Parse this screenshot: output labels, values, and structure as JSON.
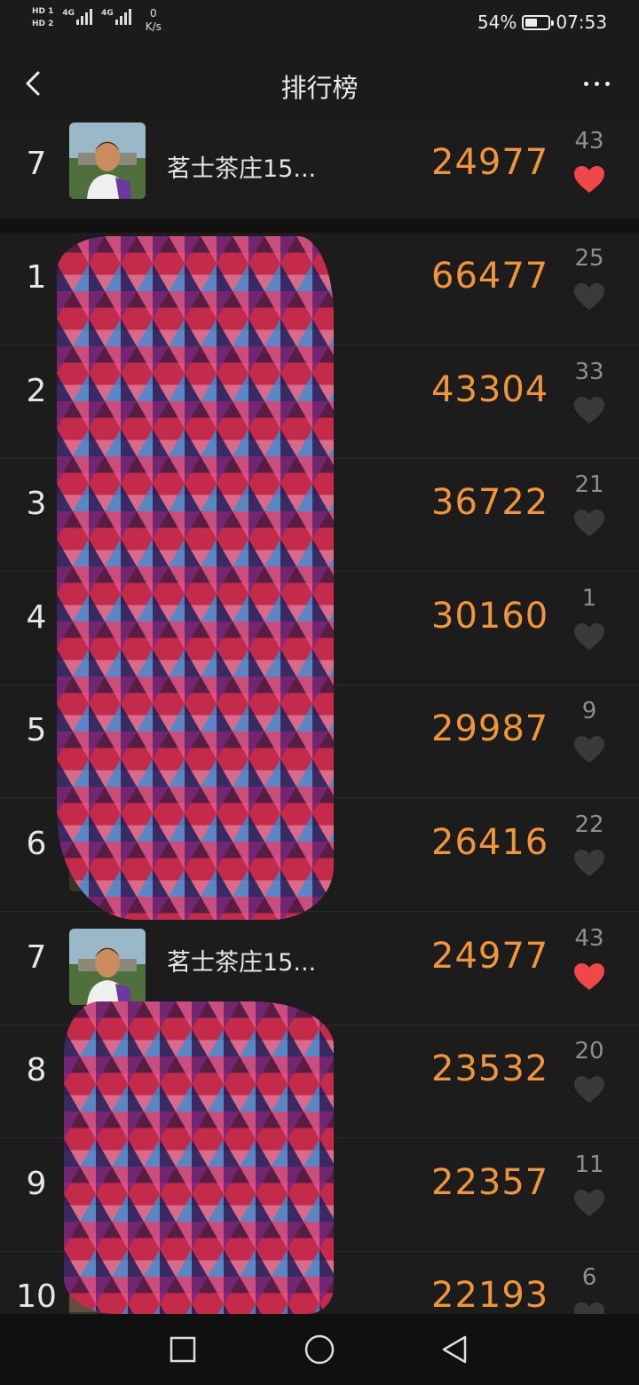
{
  "status_bar": {
    "sim1": "HD 1",
    "sim2": "HD 2",
    "net1": "4G",
    "net2": "4G",
    "speed_value": "0",
    "speed_unit": "K/s",
    "battery_percent": "54%",
    "battery_level": 0.54,
    "time": "07:53"
  },
  "header": {
    "title": "排行榜",
    "back_icon": "chevron-left-icon",
    "more_icon": "more-dots-icon"
  },
  "my_rank": {
    "rank": "7",
    "name": "茗士茶庄15...",
    "score": "24977",
    "likes": "43",
    "liked": true
  },
  "leaderboard": [
    {
      "rank": "1",
      "name": "",
      "score": "66477",
      "likes": "25",
      "liked": false
    },
    {
      "rank": "2",
      "name": "",
      "score": "43304",
      "likes": "33",
      "liked": false
    },
    {
      "rank": "3",
      "name": "",
      "score": "36722",
      "likes": "21",
      "liked": false
    },
    {
      "rank": "4",
      "name": "",
      "score": "30160",
      "likes": "1",
      "liked": false
    },
    {
      "rank": "5",
      "name": "",
      "score": "29987",
      "likes": "9",
      "liked": false
    },
    {
      "rank": "6",
      "name": "",
      "score": "26416",
      "likes": "22",
      "liked": false
    },
    {
      "rank": "7",
      "name": "茗士茶庄15...",
      "score": "24977",
      "likes": "43",
      "liked": true
    },
    {
      "rank": "8",
      "name": "",
      "score": "23532",
      "likes": "20",
      "liked": false
    },
    {
      "rank": "9",
      "name": "",
      "score": "22357",
      "likes": "11",
      "liked": false
    },
    {
      "rank": "10",
      "name": "",
      "score": "22193",
      "likes": "6",
      "liked": false
    }
  ],
  "colors": {
    "score": "#f0953a",
    "heart_active": "#f04848",
    "heart_inactive": "#3a3a3a",
    "background": "#1c1c1c"
  },
  "bottom_nav": {
    "recent_icon": "square-icon",
    "home_icon": "circle-icon",
    "back_icon": "triangle-back-icon"
  }
}
